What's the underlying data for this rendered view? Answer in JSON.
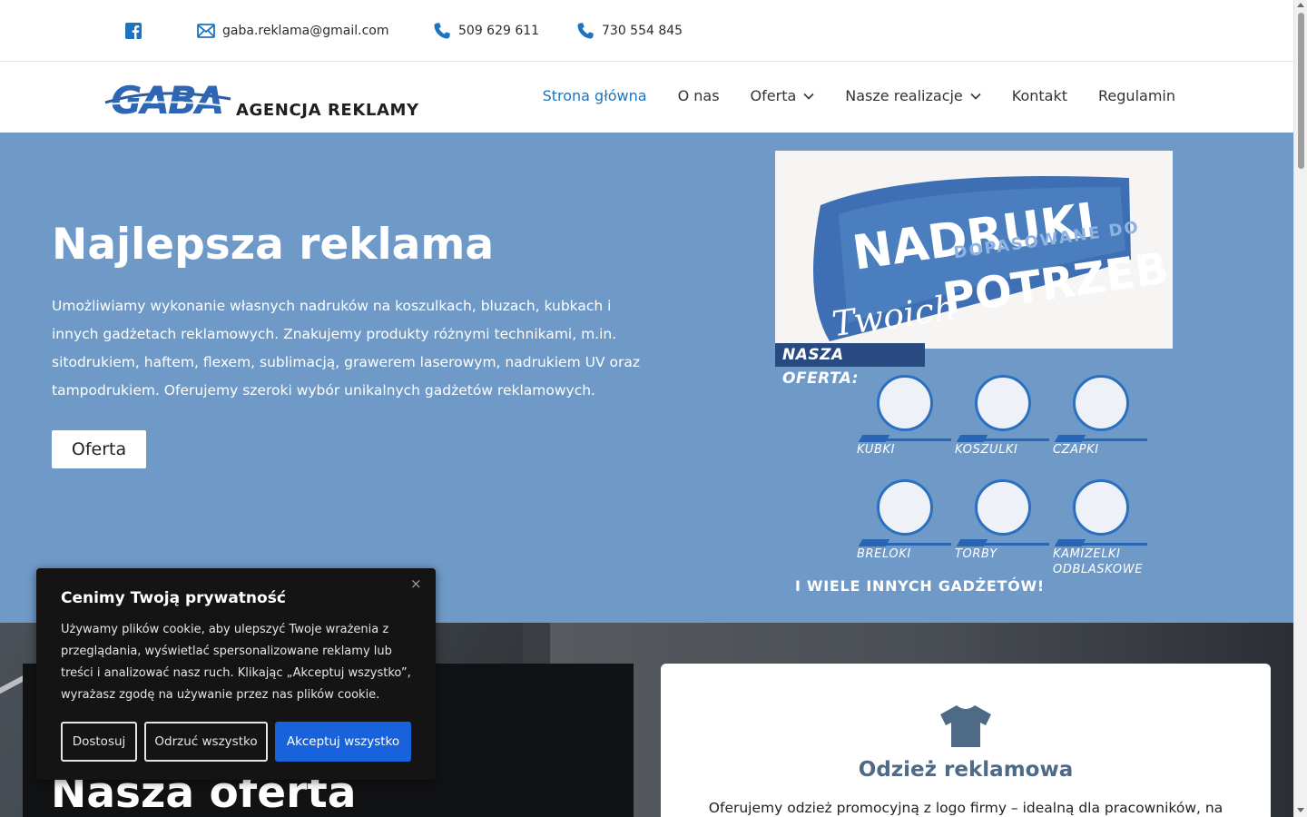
{
  "topbar": {
    "facebook_icon": "facebook-square-icon",
    "email": "gaba.reklama@gmail.com",
    "phone1": "509 629 611",
    "phone2": "730 554 845"
  },
  "header": {
    "logo_mark": "GABA",
    "logo_text": "AGENCJA REKLAMY",
    "nav": [
      {
        "label": "Strona główna",
        "active": true
      },
      {
        "label": "O nas"
      },
      {
        "label": "Oferta",
        "dropdown": true
      },
      {
        "label": "Nasze realizacje",
        "dropdown": true
      },
      {
        "label": "Kontakt"
      },
      {
        "label": "Regulamin"
      }
    ]
  },
  "hero": {
    "title": "Najlepsza reklama",
    "lead": "Umożliwiamy wykonanie własnych nadruków na koszulkach, bluzach, kubkach i innych gadżetach reklamowych. Znakujemy produkty różnymi technikami, m.in. sitodrukiem, haftem, flexem, sublimacją, grawerem laserowym, nadrukiem UV oraz tampodrukiem. Oferujemy szeroki wybór unikalnych gadżetów reklamowych.",
    "cta": "Oferta"
  },
  "poster": {
    "line1": "NADRUKI",
    "line2": "DOPASOWANE DO",
    "line3_script": "Twoich",
    "line3": "POTRZEB",
    "offer_label": "NASZA OFERTA:",
    "products": [
      "KUBKI",
      "KOSZULKI",
      "CZAPKI",
      "BRELOKI",
      "TORBY",
      "KAMIZELKI ODBLASKOWE"
    ],
    "footer": "I WIELE INNYCH GADŻETÓW!"
  },
  "offer_section": {
    "title": "Nasza oferta",
    "card_title": "Odzież reklamowa",
    "card_text": "Oferujemy odzież promocyjną z logo firmy – idealną dla pracowników, na"
  },
  "cookie": {
    "title": "Cenimy Twoją prywatność",
    "body": "Używamy plików cookie, aby ulepszyć Twoje wrażenia z przeglądania, wyświetlać spersonalizowane reklamy lub treści i analizować nasz ruch. Klikając „Akceptuj wszystko”, wyrażasz zgodę na używanie przez nas plików cookie.",
    "btn_customize": "Dostosuj",
    "btn_reject": "Odrzuć wszystko",
    "btn_accept": "Akceptuj wszystko",
    "close": "×"
  },
  "colors": {
    "hero_bg": "#6f9ac8",
    "nav_active": "#1e73be",
    "accept_btn": "#1863dc",
    "card_title": "#4f6a87"
  }
}
